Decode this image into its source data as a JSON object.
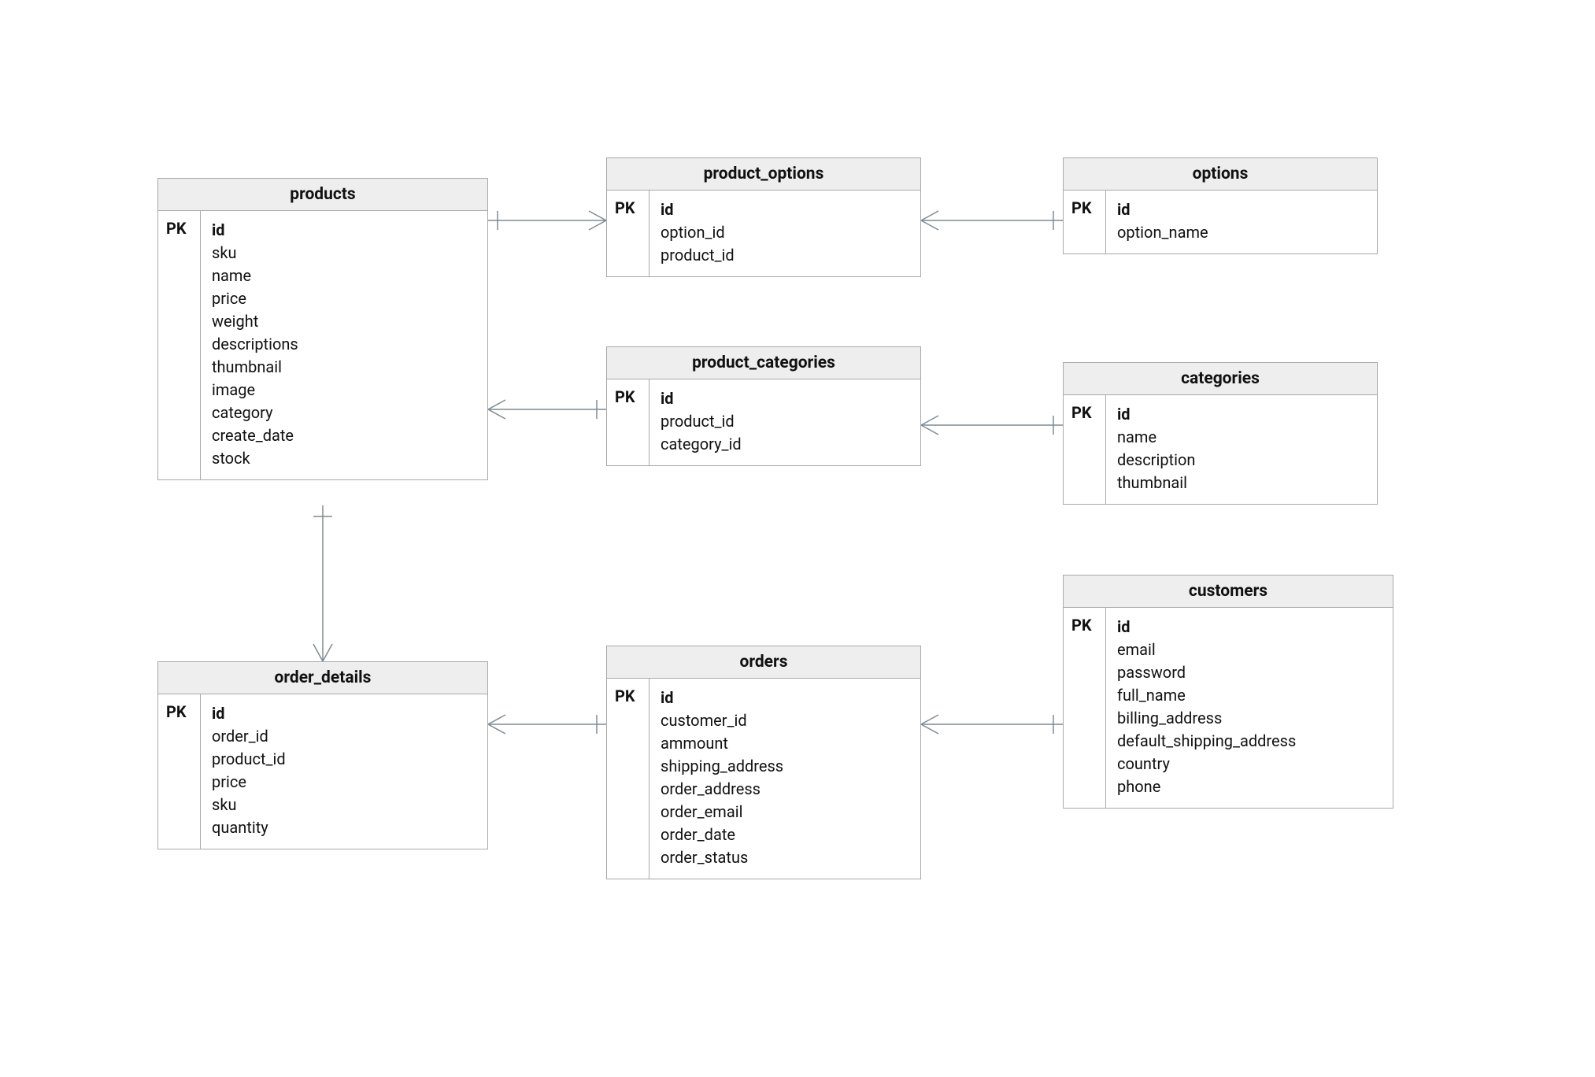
{
  "pk_label": "PK",
  "entities": {
    "products": {
      "title": "products",
      "pk": "id",
      "fields": [
        "sku",
        "name",
        "price",
        "weight",
        "descriptions",
        "thumbnail",
        "image",
        "category",
        "create_date",
        "stock"
      ]
    },
    "product_options": {
      "title": "product_options",
      "pk": "id",
      "fields": [
        "option_id",
        "product_id"
      ]
    },
    "options": {
      "title": "options",
      "pk": "id",
      "fields": [
        "option_name"
      ]
    },
    "product_categories": {
      "title": "product_categories",
      "pk": "id",
      "fields": [
        "product_id",
        "category_id"
      ]
    },
    "categories": {
      "title": "categories",
      "pk": "id",
      "fields": [
        "name",
        "description",
        "thumbnail"
      ]
    },
    "order_details": {
      "title": "order_details",
      "pk": "id",
      "fields": [
        "order_id",
        "product_id",
        "price",
        "sku",
        "quantity"
      ]
    },
    "orders": {
      "title": "orders",
      "pk": "id",
      "fields": [
        "customer_id",
        "ammount",
        "shipping_address",
        "order_address",
        "order_email",
        "order_date",
        "order_status"
      ]
    },
    "customers": {
      "title": "customers",
      "pk": "id",
      "fields": [
        "email",
        "password",
        "full_name",
        "billing_address",
        "default_shipping_address",
        "country",
        "phone"
      ]
    }
  }
}
